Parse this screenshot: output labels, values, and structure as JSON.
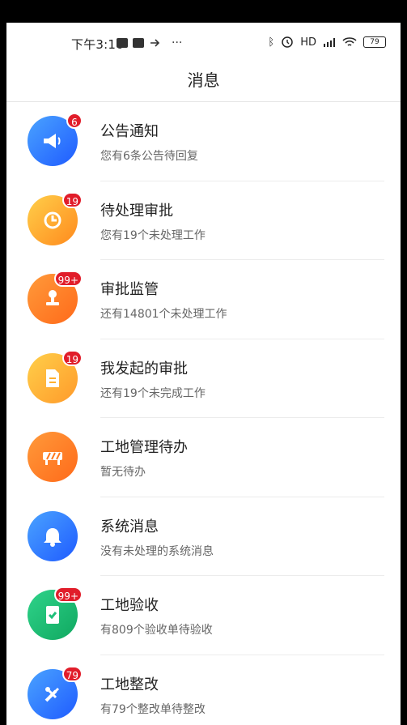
{
  "status_bar": {
    "time": "下午3:16",
    "battery": "79",
    "network": "HD"
  },
  "header": {
    "title": "消息"
  },
  "colors": {
    "blue": "#2f73ff",
    "orange": "#ff8a1d",
    "green": "#1fbf7a",
    "badge": "#e11d2a"
  },
  "items": [
    {
      "label": "公告通知",
      "subtitle": "您有6条公告待回复",
      "badge": "6",
      "icon": "megaphone-icon",
      "color": "blue"
    },
    {
      "label": "待处理审批",
      "subtitle": "您有19个未处理工作",
      "badge": "19",
      "icon": "clock-refresh-icon",
      "color": "orange"
    },
    {
      "label": "审批监管",
      "subtitle": "还有14801个未处理工作",
      "badge": "99+",
      "icon": "stamp-icon",
      "color": "orange"
    },
    {
      "label": "我发起的审批",
      "subtitle": "还有19个未完成工作",
      "badge": "19",
      "icon": "document-icon",
      "color": "orange"
    },
    {
      "label": "工地管理待办",
      "subtitle": "暂无待办",
      "badge": "",
      "icon": "barrier-icon",
      "color": "orange"
    },
    {
      "label": "系统消息",
      "subtitle": "没有未处理的系统消息",
      "badge": "",
      "icon": "bell-icon",
      "color": "blue"
    },
    {
      "label": "工地验收",
      "subtitle": "有809个验收单待验收",
      "badge": "99+",
      "icon": "checklist-icon",
      "color": "green"
    },
    {
      "label": "工地整改",
      "subtitle": "有79个整改单待整改",
      "badge": "79",
      "icon": "tools-icon",
      "color": "blue"
    }
  ]
}
